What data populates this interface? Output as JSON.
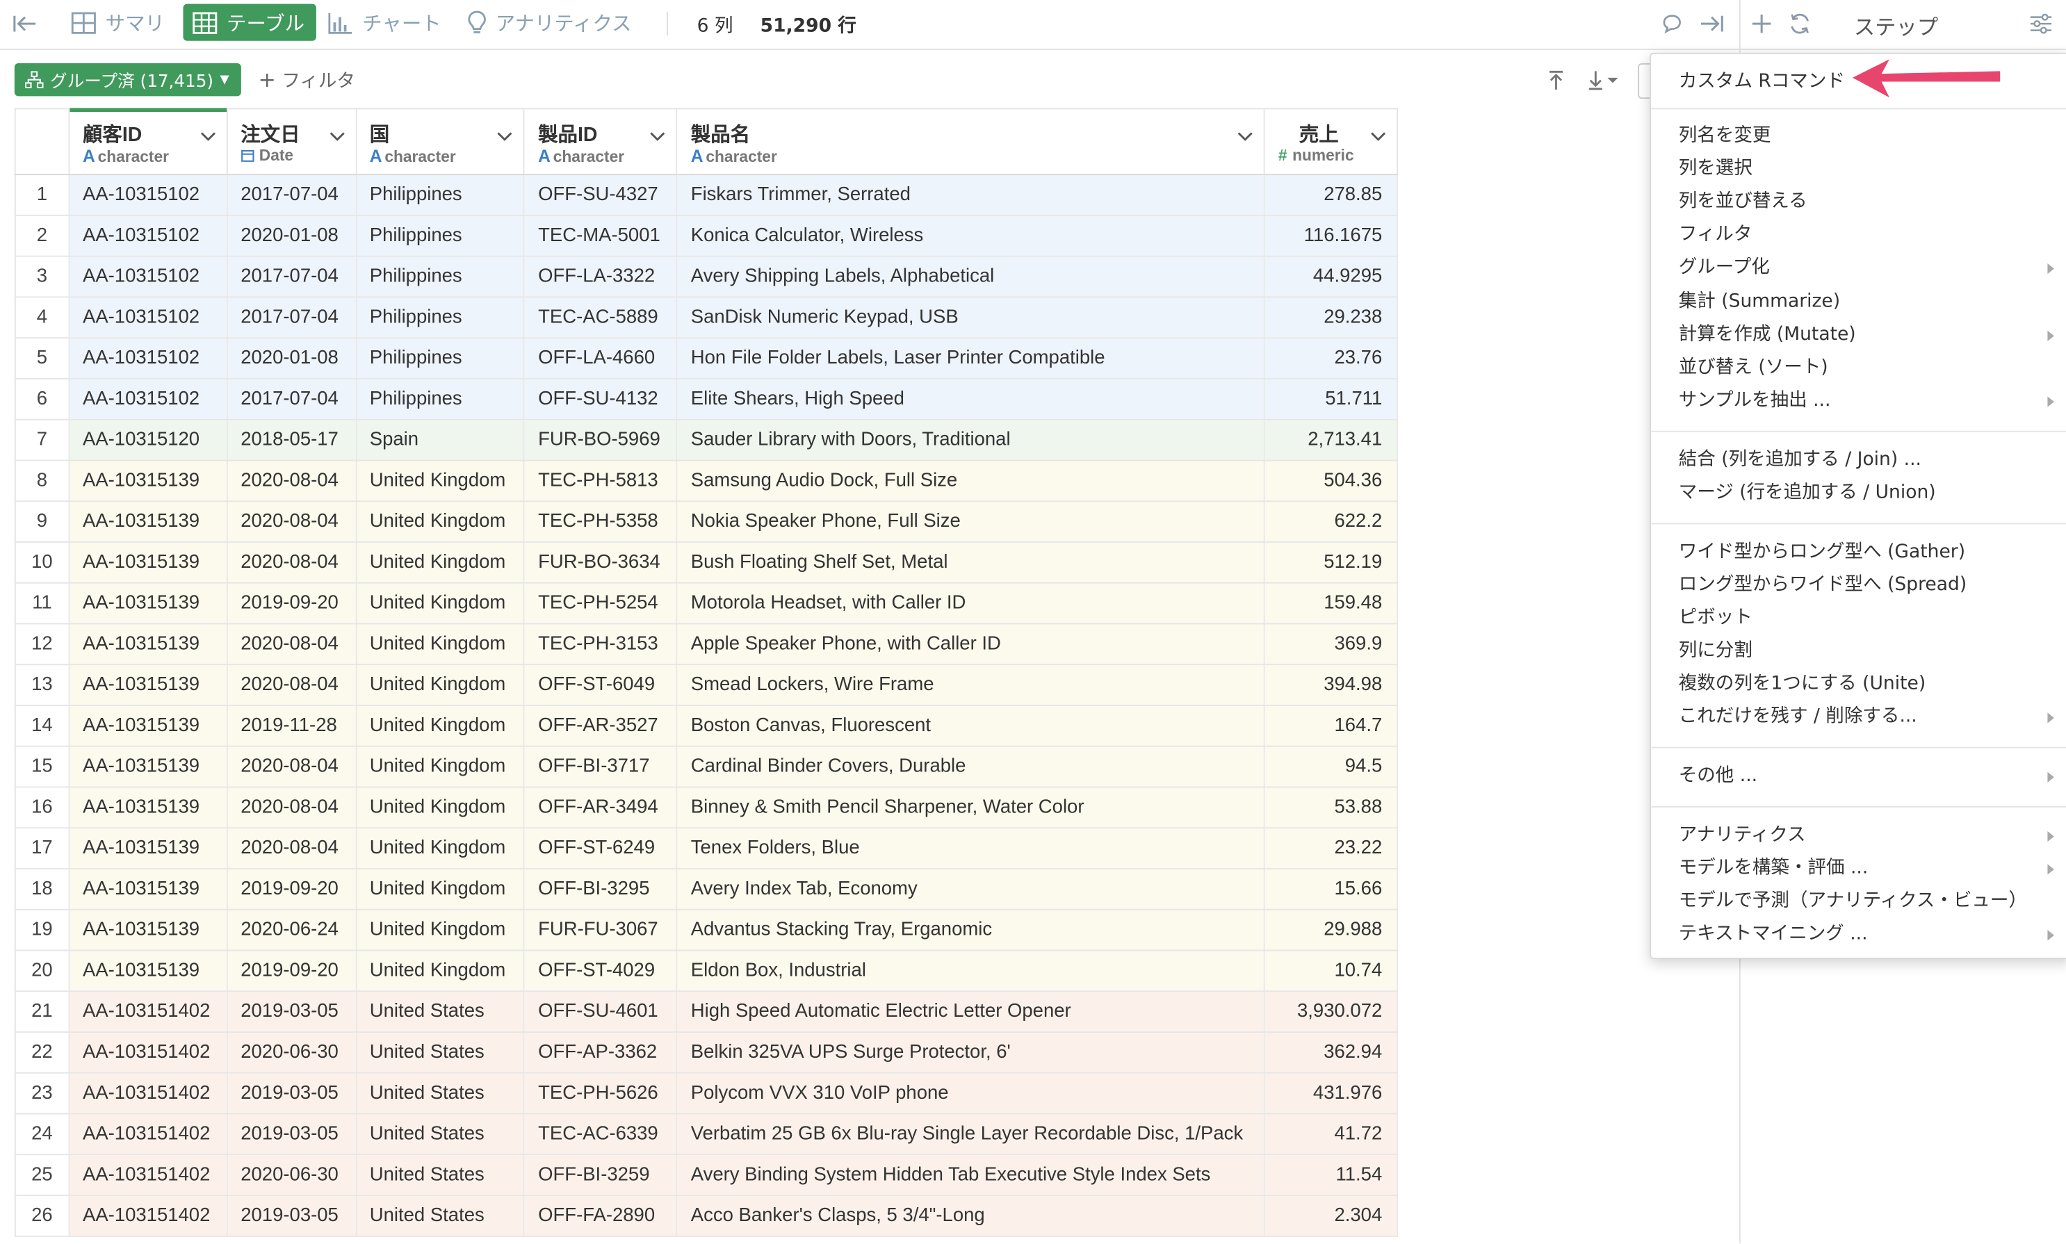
{
  "toolbar": {
    "summary_label": "サマリ",
    "table_label": "テーブル",
    "chart_label": "チャート",
    "analytics_label": "アナリティクス",
    "columns_count": "6 列",
    "rows_count": "51,290 行",
    "accent_color": "#3f9a5b"
  },
  "step_panel": {
    "title": "ステップ"
  },
  "filter_bar": {
    "grouped_label": "グループ済 (17,415)",
    "filter_label": "フィルタ"
  },
  "table": {
    "columns": [
      {
        "name": "顧客ID",
        "type": "character"
      },
      {
        "name": "注文日",
        "type": "Date"
      },
      {
        "name": "国",
        "type": "character"
      },
      {
        "name": "製品ID",
        "type": "character"
      },
      {
        "name": "製品名",
        "type": "character"
      },
      {
        "name": "売上",
        "type": "numeric"
      }
    ],
    "rows": [
      {
        "n": "1",
        "g": "g1",
        "c": [
          "AA-10315102",
          "2017-07-04",
          "Philippines",
          "OFF-SU-4327",
          "Fiskars Trimmer, Serrated",
          "278.85"
        ]
      },
      {
        "n": "2",
        "g": "g1",
        "c": [
          "AA-10315102",
          "2020-01-08",
          "Philippines",
          "TEC-MA-5001",
          "Konica Calculator, Wireless",
          "116.1675"
        ]
      },
      {
        "n": "3",
        "g": "g1",
        "c": [
          "AA-10315102",
          "2017-07-04",
          "Philippines",
          "OFF-LA-3322",
          "Avery Shipping Labels, Alphabetical",
          "44.9295"
        ]
      },
      {
        "n": "4",
        "g": "g1",
        "c": [
          "AA-10315102",
          "2017-07-04",
          "Philippines",
          "TEC-AC-5889",
          "SanDisk Numeric Keypad, USB",
          "29.238"
        ]
      },
      {
        "n": "5",
        "g": "g1",
        "c": [
          "AA-10315102",
          "2020-01-08",
          "Philippines",
          "OFF-LA-4660",
          "Hon File Folder Labels, Laser Printer Compatible",
          "23.76"
        ]
      },
      {
        "n": "6",
        "g": "g1",
        "c": [
          "AA-10315102",
          "2017-07-04",
          "Philippines",
          "OFF-SU-4132",
          "Elite Shears, High Speed",
          "51.711"
        ]
      },
      {
        "n": "7",
        "g": "g2",
        "c": [
          "AA-10315120",
          "2018-05-17",
          "Spain",
          "FUR-BO-5969",
          "Sauder Library with Doors, Traditional",
          "2,713.41"
        ]
      },
      {
        "n": "8",
        "g": "g3",
        "c": [
          "AA-10315139",
          "2020-08-04",
          "United Kingdom",
          "TEC-PH-5813",
          "Samsung Audio Dock, Full Size",
          "504.36"
        ]
      },
      {
        "n": "9",
        "g": "g3",
        "c": [
          "AA-10315139",
          "2020-08-04",
          "United Kingdom",
          "TEC-PH-5358",
          "Nokia Speaker Phone, Full Size",
          "622.2"
        ]
      },
      {
        "n": "10",
        "g": "g3",
        "c": [
          "AA-10315139",
          "2020-08-04",
          "United Kingdom",
          "FUR-BO-3634",
          "Bush Floating Shelf Set, Metal",
          "512.19"
        ]
      },
      {
        "n": "11",
        "g": "g3",
        "c": [
          "AA-10315139",
          "2019-09-20",
          "United Kingdom",
          "TEC-PH-5254",
          "Motorola Headset, with Caller ID",
          "159.48"
        ]
      },
      {
        "n": "12",
        "g": "g3",
        "c": [
          "AA-10315139",
          "2020-08-04",
          "United Kingdom",
          "TEC-PH-3153",
          "Apple Speaker Phone, with Caller ID",
          "369.9"
        ]
      },
      {
        "n": "13",
        "g": "g3",
        "c": [
          "AA-10315139",
          "2020-08-04",
          "United Kingdom",
          "OFF-ST-6049",
          "Smead Lockers, Wire Frame",
          "394.98"
        ]
      },
      {
        "n": "14",
        "g": "g3",
        "c": [
          "AA-10315139",
          "2019-11-28",
          "United Kingdom",
          "OFF-AR-3527",
          "Boston Canvas, Fluorescent",
          "164.7"
        ]
      },
      {
        "n": "15",
        "g": "g3",
        "c": [
          "AA-10315139",
          "2020-08-04",
          "United Kingdom",
          "OFF-BI-3717",
          "Cardinal Binder Covers, Durable",
          "94.5"
        ]
      },
      {
        "n": "16",
        "g": "g3",
        "c": [
          "AA-10315139",
          "2020-08-04",
          "United Kingdom",
          "OFF-AR-3494",
          "Binney & Smith Pencil Sharpener, Water Color",
          "53.88"
        ]
      },
      {
        "n": "17",
        "g": "g3",
        "c": [
          "AA-10315139",
          "2020-08-04",
          "United Kingdom",
          "OFF-ST-6249",
          "Tenex Folders, Blue",
          "23.22"
        ]
      },
      {
        "n": "18",
        "g": "g3",
        "c": [
          "AA-10315139",
          "2019-09-20",
          "United Kingdom",
          "OFF-BI-3295",
          "Avery Index Tab, Economy",
          "15.66"
        ]
      },
      {
        "n": "19",
        "g": "g3",
        "c": [
          "AA-10315139",
          "2020-06-24",
          "United Kingdom",
          "FUR-FU-3067",
          "Advantus Stacking Tray, Erganomic",
          "29.988"
        ]
      },
      {
        "n": "20",
        "g": "g3",
        "c": [
          "AA-10315139",
          "2019-09-20",
          "United Kingdom",
          "OFF-ST-4029",
          "Eldon Box, Industrial",
          "10.74"
        ]
      },
      {
        "n": "21",
        "g": "g4",
        "c": [
          "AA-103151402",
          "2019-03-05",
          "United States",
          "OFF-SU-4601",
          "High Speed Automatic Electric Letter Opener",
          "3,930.072"
        ]
      },
      {
        "n": "22",
        "g": "g4",
        "c": [
          "AA-103151402",
          "2020-06-30",
          "United States",
          "OFF-AP-3362",
          "Belkin 325VA UPS Surge Protector, 6'",
          "362.94"
        ]
      },
      {
        "n": "23",
        "g": "g4",
        "c": [
          "AA-103151402",
          "2019-03-05",
          "United States",
          "TEC-PH-5626",
          "Polycom VVX 310 VoIP phone",
          "431.976"
        ]
      },
      {
        "n": "24",
        "g": "g4",
        "c": [
          "AA-103151402",
          "2019-03-05",
          "United States",
          "TEC-AC-6339",
          "Verbatim 25 GB 6x Blu-ray Single Layer Recordable Disc, 1/Pack",
          "41.72"
        ]
      },
      {
        "n": "25",
        "g": "g4",
        "c": [
          "AA-103151402",
          "2020-06-30",
          "United States",
          "OFF-BI-3259",
          "Avery Binding System Hidden Tab Executive Style Index Sets",
          "11.54"
        ]
      },
      {
        "n": "26",
        "g": "g4",
        "c": [
          "AA-103151402",
          "2019-03-05",
          "United States",
          "OFF-FA-2890",
          "Acco Banker's Clasps, 5 3/4\"-Long",
          "2.304"
        ]
      }
    ]
  },
  "menu": {
    "items": [
      {
        "label": "カスタム Rコマンド",
        "submenu": false
      },
      {
        "label": "列名を変更",
        "submenu": false
      },
      {
        "label": "列を選択",
        "submenu": false
      },
      {
        "label": "列を並び替える",
        "submenu": false
      },
      {
        "label": "フィルタ",
        "submenu": false
      },
      {
        "label": "グループ化",
        "submenu": true
      },
      {
        "label": "集計 (Summarize)",
        "submenu": false
      },
      {
        "label": "計算を作成 (Mutate)",
        "submenu": true
      },
      {
        "label": "並び替え (ソート)",
        "submenu": false
      },
      {
        "label": "サンプルを抽出 ...",
        "submenu": true
      },
      {
        "label": "結合 (列を追加する / Join) ...",
        "submenu": false
      },
      {
        "label": "マージ (行を追加する / Union)",
        "submenu": false
      },
      {
        "label": "ワイド型からロング型へ (Gather)",
        "submenu": false
      },
      {
        "label": "ロング型からワイド型へ (Spread)",
        "submenu": false
      },
      {
        "label": "ピボット",
        "submenu": false
      },
      {
        "label": "列に分割",
        "submenu": false
      },
      {
        "label": "複数の列を1つにする (Unite)",
        "submenu": false
      },
      {
        "label": "これだけを残す / 削除する...",
        "submenu": true
      },
      {
        "label": "その他 ...",
        "submenu": true
      },
      {
        "label": "アナリティクス",
        "submenu": true
      },
      {
        "label": "モデルを構築・評価 ...",
        "submenu": true
      },
      {
        "label": "モデルで予測（アナリティクス・ビュー）",
        "submenu": false
      },
      {
        "label": "テキストマイニング ...",
        "submenu": true
      }
    ],
    "pointer_color": "#e8456e"
  }
}
